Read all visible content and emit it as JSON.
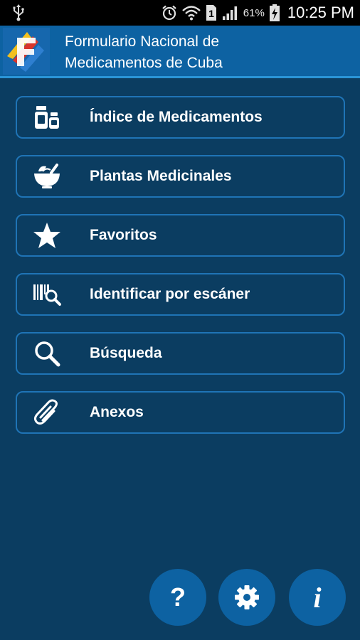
{
  "status_bar": {
    "battery_percent": "61%",
    "time": "10:25 PM",
    "sim_label": "1",
    "icons": [
      "usb-icon",
      "alarm-icon",
      "wifi-icon",
      "sim-icon",
      "signal-icon",
      "battery-charging-icon"
    ]
  },
  "header": {
    "title_line1": "Formulario Nacional de",
    "title_line2": "Medicamentos de Cuba",
    "logo_icon": "formulario-logo-icon"
  },
  "menu": {
    "items": [
      {
        "label": "Índice de Medicamentos",
        "icon": "medicine-bottles-icon"
      },
      {
        "label": "Plantas Medicinales",
        "icon": "mortar-herbs-icon"
      },
      {
        "label": "Favoritos",
        "icon": "star-icon"
      },
      {
        "label": "Identificar por escáner",
        "icon": "barcode-scan-icon"
      },
      {
        "label": "Búsqueda",
        "icon": "search-icon"
      },
      {
        "label": "Anexos",
        "icon": "paperclip-icon"
      }
    ]
  },
  "footer_buttons": [
    {
      "icon": "help-icon",
      "glyph": "?"
    },
    {
      "icon": "gear-icon"
    },
    {
      "icon": "info-icon",
      "glyph": "i"
    }
  ],
  "colors": {
    "background": "#0b3d61",
    "header": "#0d62a2",
    "header_border": "#2a95d8",
    "item_border": "#1f74b6",
    "status_bar": "#000000",
    "text": "#ffffff"
  }
}
